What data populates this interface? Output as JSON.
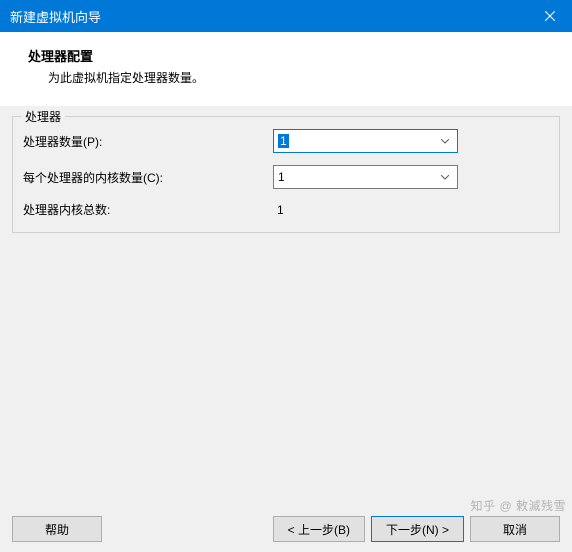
{
  "titlebar": {
    "title": "新建虚拟机向导"
  },
  "header": {
    "title": "处理器配置",
    "subtitle": "为此虚拟机指定处理器数量。"
  },
  "fieldset": {
    "legend": "处理器",
    "rows": {
      "processors": {
        "label": "处理器数量(P):",
        "value": "1"
      },
      "cores": {
        "label": "每个处理器的内核数量(C):",
        "value": "1"
      },
      "total": {
        "label": "处理器内核总数:",
        "value": "1"
      }
    }
  },
  "footer": {
    "help": "帮助",
    "back": "< 上一步(B)",
    "next": "下一步(N) >",
    "cancel": "取消"
  },
  "watermark": "知乎 @ 敕滅残雪"
}
